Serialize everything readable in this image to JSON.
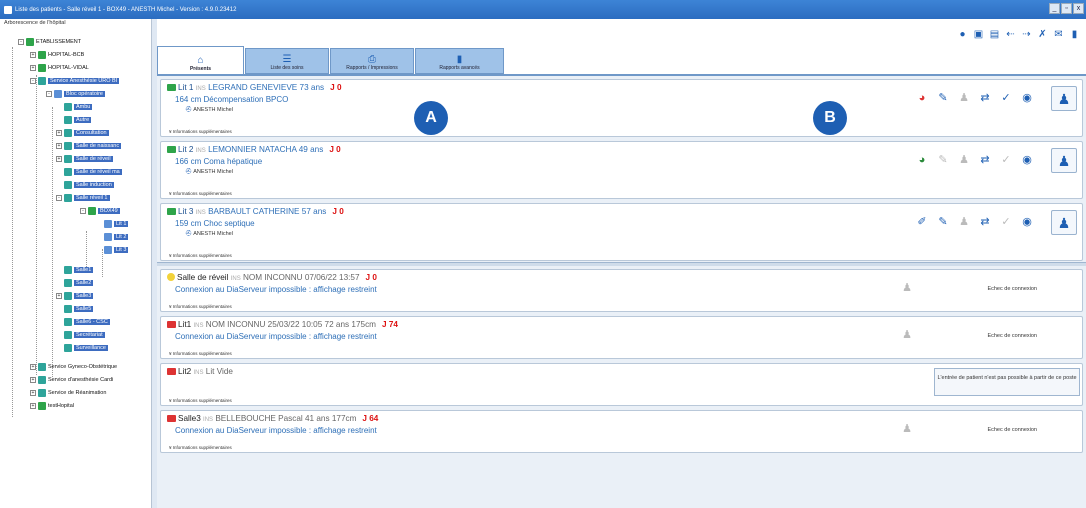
{
  "window": {
    "title": "Liste des patients - Salle réveil 1 - BOX49 - ANESTH Michel - Version : 4.9.0.23412",
    "controls": [
      "_",
      "▫",
      "x"
    ]
  },
  "tree": {
    "header": "Arborescence de l'hôpital",
    "nodes": [
      {
        "label": "ETABLISSEMENT"
      },
      {
        "label": "HOPITAL-BCB"
      },
      {
        "label": "HOPITAL-VIDAL"
      },
      {
        "label": "Service Anesthésie URO BI"
      },
      {
        "label": "Bloc opératoire"
      },
      {
        "label": "Ambu"
      },
      {
        "label": "Autre"
      },
      {
        "label": "Consultation"
      },
      {
        "label": "Salle de naissanc"
      },
      {
        "label": "Salle de réveil"
      },
      {
        "label": "Salle de réveil ma"
      },
      {
        "label": "Salle induction"
      },
      {
        "label": "Salle réveil 1"
      },
      {
        "label": "BOX49"
      },
      {
        "label": "Lit 1"
      },
      {
        "label": "Lit 2"
      },
      {
        "label": "Lit 3"
      },
      {
        "label": "Salle1"
      },
      {
        "label": "Salle2"
      },
      {
        "label": "Salle3"
      },
      {
        "label": "Salle5"
      },
      {
        "label": "Salle6 - CSC"
      },
      {
        "label": "Secrétariat"
      },
      {
        "label": "Surveillance"
      },
      {
        "label": "Service Gyneco-Obstétrique"
      },
      {
        "label": "Service d'anesthésie Cardi"
      },
      {
        "label": "Service de Réanimation"
      },
      {
        "label": "testHopital"
      }
    ]
  },
  "tabs": [
    {
      "label": "Présents",
      "icon": "home-icon"
    },
    {
      "label": "Liste des soins",
      "icon": "list-icon"
    },
    {
      "label": "Rapports / Impressions",
      "icon": "printer-icon"
    },
    {
      "label": "Rapports avancés",
      "icon": "document-icon"
    }
  ],
  "patients": [
    {
      "bed": "Lit 1",
      "ins": "INS",
      "name": "LEGRAND GENEVIEVE 73 ans",
      "j": "J 0",
      "detail": "164 cm Décompensation BPCO",
      "doctor": "ANESTH Michel",
      "info": "Informations supplémentaires"
    },
    {
      "bed": "Lit 2",
      "ins": "INS",
      "name": "LEMONNIER NATACHA 49 ans",
      "j": "J 0",
      "detail": "166 cm Coma hépatique",
      "doctor": "ANESTH Michel",
      "info": "Informations supplémentaires"
    },
    {
      "bed": "Lit 3",
      "ins": "INS",
      "name": "BARBAULT CATHERINE 57 ans",
      "j": "J 0",
      "detail": "159 cm Choc septique",
      "doctor": "ANESTH Michel",
      "info": "Informations supplémentaires"
    }
  ],
  "others": [
    {
      "bed": "Salle de réveil",
      "ins": "INS",
      "name": "NOM INCONNU 07/06/22 13:57",
      "j": "J 0",
      "detail": "Connexion au DiaServeur impossible : affichage restreint",
      "status": "Echec de connexion",
      "info": "Informations supplémentaires"
    },
    {
      "bed": "Lit1",
      "ins": "INS",
      "name": "NOM INCONNU 25/03/22 10:05 72 ans 175cm",
      "j": "J 74",
      "detail": "Connexion au DiaServeur impossible : affichage restreint",
      "status": "Echec de connexion",
      "info": "Informations supplémentaires"
    },
    {
      "bed": "Lit2",
      "ins": "INS",
      "name": "Lit Vide",
      "j": "",
      "detail": "",
      "status": "L'entrée de patient n'est pas possible à partir de ce poste",
      "info": "Informations supplémentaires"
    },
    {
      "bed": "Salle3",
      "ins": "INS",
      "name": "BELLEBOUCHE Pascal 41 ans 177cm",
      "j": "J 64",
      "detail": "Connexion au DiaServeur impossible : affichage restreint",
      "status": "Echec de connexion",
      "info": "Informations supplémentaires"
    }
  ],
  "markers": {
    "a": "A",
    "b": "B"
  },
  "colors": {
    "accent": "#1e5fb3",
    "selected": "#3d6cc0",
    "alert": "#d11111"
  }
}
